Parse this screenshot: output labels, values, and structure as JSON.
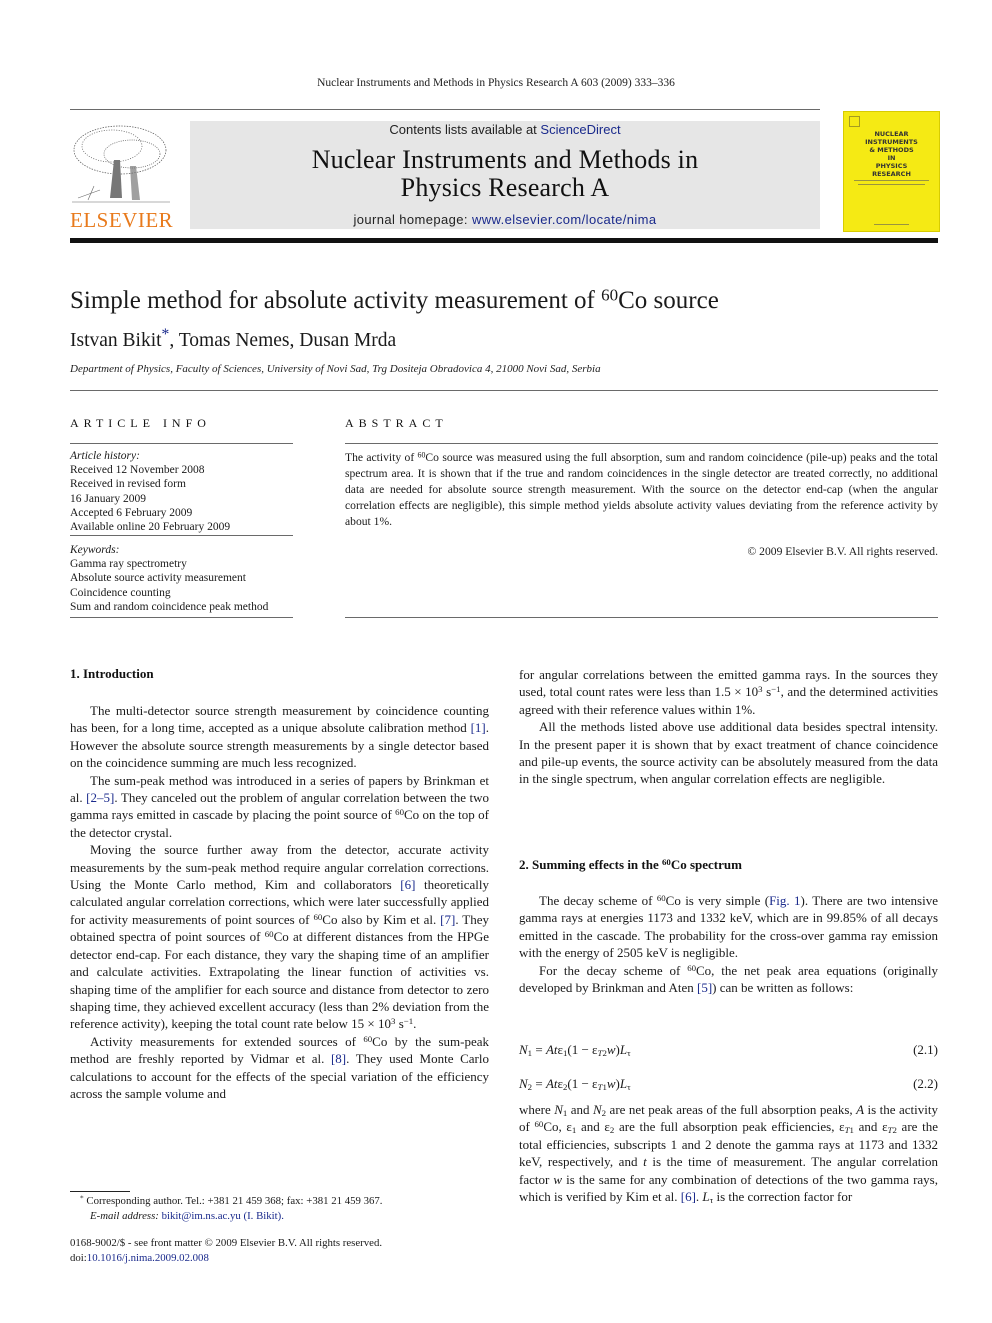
{
  "running_head": "Nuclear Instruments and Methods in Physics Research A 603 (2009) 333–336",
  "masthead": {
    "contents_prefix": "Contents lists available at ",
    "contents_link": "ScienceDirect",
    "journal_title_line1": "Nuclear Instruments and Methods in",
    "journal_title_line2": "Physics Research A",
    "homepage_prefix": "journal homepage: ",
    "homepage_link": "www.elsevier.com/locate/nima",
    "publisher_logo_text": "ELSEVIER",
    "cover_title_lines": [
      "NUCLEAR",
      "INSTRUMENTS",
      "& METHODS",
      "IN",
      "PHYSICS",
      "RESEARCH"
    ]
  },
  "article": {
    "title_prefix": "Simple method for absolute activity measurement of ",
    "title_isotope_mass": "60",
    "title_suffix": "Co source",
    "authors": [
      {
        "name": "Istvan Bikit",
        "mark": "*"
      },
      {
        "name": "Tomas Nemes"
      },
      {
        "name": "Dusan Mrda"
      }
    ],
    "affiliation": "Department of Physics, Faculty of Sciences, University of Novi Sad, Trg Dositeja Obradovica 4, 21000 Novi Sad, Serbia"
  },
  "article_info": {
    "heading": "ARTICLE INFO",
    "history_label": "Article history:",
    "history": [
      "Received 12 November 2008",
      "Received in revised form",
      "16 January 2009",
      "Accepted 6 February 2009",
      "Available online 20 February 2009"
    ],
    "keywords_label": "Keywords:",
    "keywords": [
      "Gamma ray spectrometry",
      "Absolute source activity measurement",
      "Coincidence counting",
      "Sum and random coincidence peak method"
    ]
  },
  "abstract": {
    "heading": "ABSTRACT",
    "text_a": "The activity of ",
    "text_b": "Co source was measured using the full absorption, sum and random coincidence (pile-up) peaks and the total spectrum area. It is shown that if the true and random coincidences in the single detector are treated correctly, no additional data are needed for absolute source strength measurement. With the source on the detector end-cap (when the angular correlation effects are negligible), this simple method yields absolute activity values deviating from the reference activity by about 1%.",
    "copyright": "© 2009 Elsevier B.V. All rights reserved."
  },
  "section1": {
    "heading": "1.  Introduction",
    "p1_a": "The multi-detector source strength measurement by coincidence counting has been, for a long time, accepted as a unique absolute calibration method ",
    "p1_ref": "[1]",
    "p1_b": ". However the absolute source strength measurements by a single detector based on the coincidence summing are much less recognized.",
    "p2_a": "The sum-peak method was introduced in a series of papers by Brinkman et al. ",
    "p2_ref": "[2–5]",
    "p2_b": ". They canceled out the problem of angular correlation between the two gamma rays emitted in cascade by placing the point source of ",
    "p2_c": "Co on the top of the detector crystal.",
    "p3_a": "Moving the source further away from the detector, accurate activity measurements by the sum-peak method require angular correlation corrections. Using the Monte Carlo method, Kim and collaborators ",
    "p3_ref1": "[6]",
    "p3_b": " theoretically calculated angular correlation corrections, which were later successfully applied for activity measurements of point sources of ",
    "p3_c": "Co also by Kim et al. ",
    "p3_ref2": "[7]",
    "p3_d": ". They obtained spectra of point sources of ",
    "p3_e": "Co at different distances from the HPGe detector end-cap. For each distance, they vary the shaping time of an amplifier and calculate activities. Extrapolating the linear function of activities vs. shaping time of the amplifier for each source and distance from detector to zero shaping time, they achieved excellent accuracy (less than 2% deviation from the reference activity), keeping the total count rate below 15 × 10",
    "p3_exp": "3",
    "p3_f": " s",
    "p3_exp2": "−1",
    "p3_g": ".",
    "p4_a": "Activity measurements for extended sources of ",
    "p4_b": "Co by the sum-peak method are freshly reported by Vidmar et al. ",
    "p4_ref": "[8]",
    "p4_c": ". They used Monte Carlo calculations to account for the effects of the special variation of the efficiency across the sample volume and",
    "r1_a": "for angular correlations between the emitted gamma rays. In the sources they used, total count rates were less than 1.5 × 10",
    "r1_exp": "3",
    "r1_b": " s",
    "r1_exp2": "−1",
    "r1_c": ", and the determined activities agreed with their reference values within 1%.",
    "r2": "All the methods listed above use additional data besides spectral intensity. In the present paper it is shown that by exact treatment of chance coincidence and pile-up events, the source activity can be absolutely measured from the data in the single spectrum, when angular correlation effects are negligible."
  },
  "section2": {
    "heading_a": "2.  Summing effects in the ",
    "heading_b": "Co spectrum",
    "p1_a": "The decay scheme of ",
    "p1_b": "Co is very simple (",
    "p1_ref": "Fig. 1",
    "p1_c": "). There are two intensive gamma rays at energies 1173 and 1332 keV, which are in 99.85% of all decays emitted in the cascade. The probability for the cross-over gamma ray emission with the energy of 2505 keV is negligible.",
    "p2_a": "For the decay scheme of ",
    "p2_b": "Co, the net peak area equations (originally developed by Brinkman and Aten ",
    "p2_ref": "[5]",
    "p2_c": ") can be written as follows:",
    "eq1_label": "(2.1)",
    "eq2_label": "(2.2)",
    "p3_a": "where ",
    "p3_b": " and ",
    "p3_c": " are net peak areas of the full absorption peaks, ",
    "p3_d": " is the activity of ",
    "p3_e": "Co, ",
    "p3_f": " and ",
    "p3_g": " are the full absorption peak efficiencies, ",
    "p3_h": " and ",
    "p3_i": " are the total efficiencies, subscripts 1 and 2 denote the gamma rays at 1173 and 1332 keV, respectively, and ",
    "p3_j": " is the time of measurement. The angular correlation factor ",
    "p3_k": " is the same for any combination of detections of the two gamma rays, which is verified by Kim et al. ",
    "p3_ref": "[6]",
    "p3_l": ". ",
    "p3_m": " is the correction factor for"
  },
  "isotope_mass": "60",
  "footnotes": {
    "corresponding": "Corresponding author. Tel.: +381 21 459 368; fax: +381 21 459 367.",
    "corresponding_mark": "*",
    "email_label": "E-mail address: ",
    "email_link": "bikit@im.ns.ac.yu (I. Bikit).",
    "front_matter": "0168-9002/$ - see front matter © 2009 Elsevier B.V. All rights reserved.",
    "doi_prefix": "doi:",
    "doi_link": "10.1016/j.nima.2009.02.008"
  }
}
